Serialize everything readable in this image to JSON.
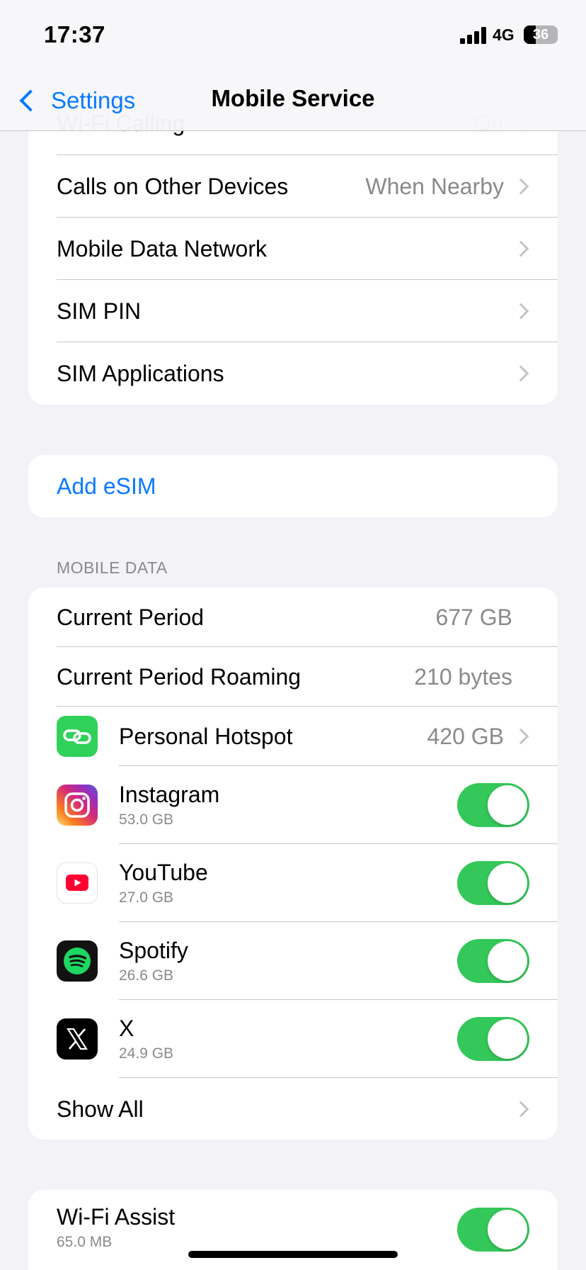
{
  "status_bar": {
    "time": "17:37",
    "network": "4G",
    "battery": "36",
    "battery_level": 0.36
  },
  "nav": {
    "back_label": "Settings",
    "title": "Mobile Service"
  },
  "group1": {
    "partial_label": "Wi-Fi Calling",
    "partial_value": "On",
    "rows": [
      {
        "label": "Calls on Other Devices",
        "value": "When Nearby"
      },
      {
        "label": "Mobile Data Network",
        "value": ""
      },
      {
        "label": "SIM PIN",
        "value": ""
      },
      {
        "label": "SIM Applications",
        "value": ""
      }
    ]
  },
  "add_esim": {
    "label": "Add eSIM"
  },
  "mobile_data": {
    "header": "MOBILE DATA",
    "current_period": {
      "label": "Current Period",
      "value": "677 GB"
    },
    "current_period_roaming": {
      "label": "Current Period Roaming",
      "value": "210 bytes"
    },
    "personal_hotspot": {
      "label": "Personal Hotspot",
      "value": "420 GB",
      "icon": "hotspot-icon"
    },
    "apps": [
      {
        "name": "Instagram",
        "usage": "53.0 GB",
        "enabled": true,
        "icon": "instagram-icon"
      },
      {
        "name": "YouTube",
        "usage": "27.0 GB",
        "enabled": true,
        "icon": "youtube-icon"
      },
      {
        "name": "Spotify",
        "usage": "26.6 GB",
        "enabled": true,
        "icon": "spotify-icon"
      },
      {
        "name": "X",
        "usage": "24.9 GB",
        "enabled": true,
        "icon": "x-icon"
      }
    ],
    "show_all": "Show All"
  },
  "wifi_assist": {
    "label": "Wi-Fi Assist",
    "usage": "65.0 MB",
    "enabled": true
  },
  "colors": {
    "accent": "#0a7aff",
    "toggle_on": "#34c759",
    "background": "#f2f2f7",
    "secondary_text": "#8a8a8e"
  }
}
